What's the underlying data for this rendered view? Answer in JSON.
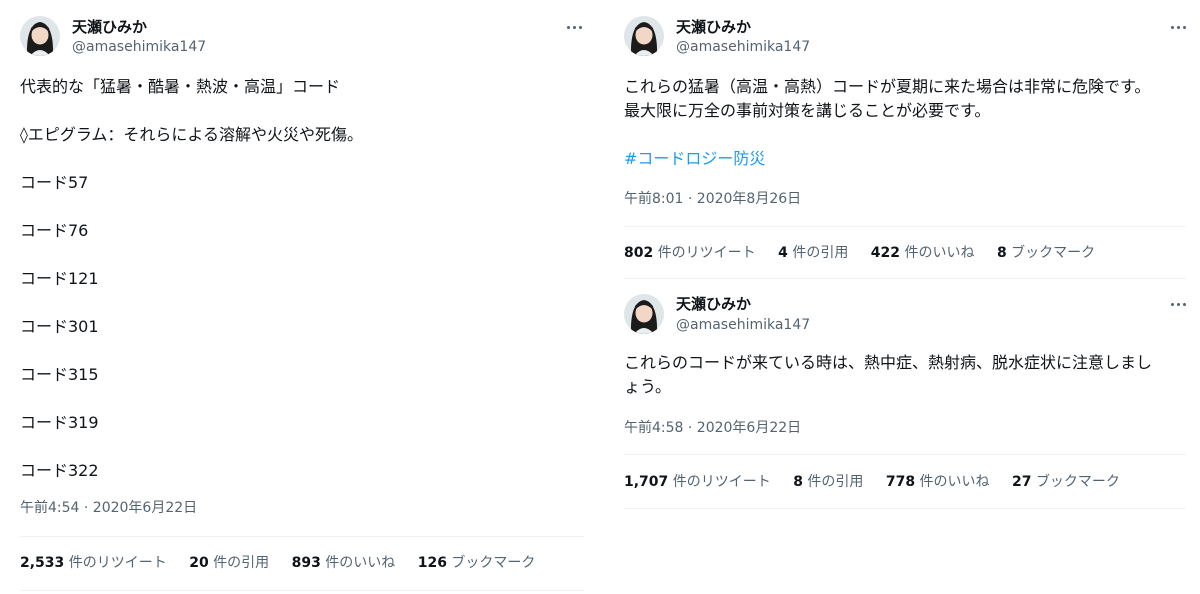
{
  "tweet1": {
    "name": "天瀬ひみか",
    "handle": "@amasehimika147",
    "text": "代表的な「猛暑・酷暑・熱波・高温」コード\n\n◊エピグラム：それらによる溶解や火災や死傷。\n\nコード57\n\nコード76\n\nコード121\n\nコード301\n\nコード315\n\nコード319\n\nコード322",
    "timestamp": "午前4:54 · 2020年6月22日",
    "retweets": "2,533",
    "retweets_label": "件のリツイート",
    "quotes": "20",
    "quotes_label": "件の引用",
    "likes": "893",
    "likes_label": "件のいいね",
    "bookmarks": "126",
    "bookmarks_label": "ブックマーク"
  },
  "tweet2": {
    "name": "天瀬ひみか",
    "handle": "@amasehimika147",
    "text": "これらの猛暑（高温・高熱）コードが夏期に来た場合は非常に危険です。\n最大限に万全の事前対策を講じることが必要です。",
    "hashtag": "#コードロジー防災",
    "timestamp": "午前8:01 · 2020年8月26日",
    "retweets": "802",
    "retweets_label": "件のリツイート",
    "quotes": "4",
    "quotes_label": "件の引用",
    "likes": "422",
    "likes_label": "件のいいね",
    "bookmarks": "8",
    "bookmarks_label": "ブックマーク"
  },
  "tweet3": {
    "name": "天瀬ひみか",
    "handle": "@amasehimika147",
    "text": "これらのコードが来ている時は、熱中症、熱射病、脱水症状に注意しまし\nょう。",
    "timestamp": "午前4:58 · 2020年6月22日",
    "retweets": "1,707",
    "retweets_label": "件のリツイート",
    "quotes": "8",
    "quotes_label": "件の引用",
    "likes": "778",
    "likes_label": "件のいいね",
    "bookmarks": "27",
    "bookmarks_label": "ブックマーク"
  },
  "icons": [
    "avatar",
    "more-options-icon"
  ],
  "colors": {
    "text": "#0f1419",
    "secondary": "#536471",
    "link": "#1d9bf0",
    "divider": "#eff3f4"
  }
}
